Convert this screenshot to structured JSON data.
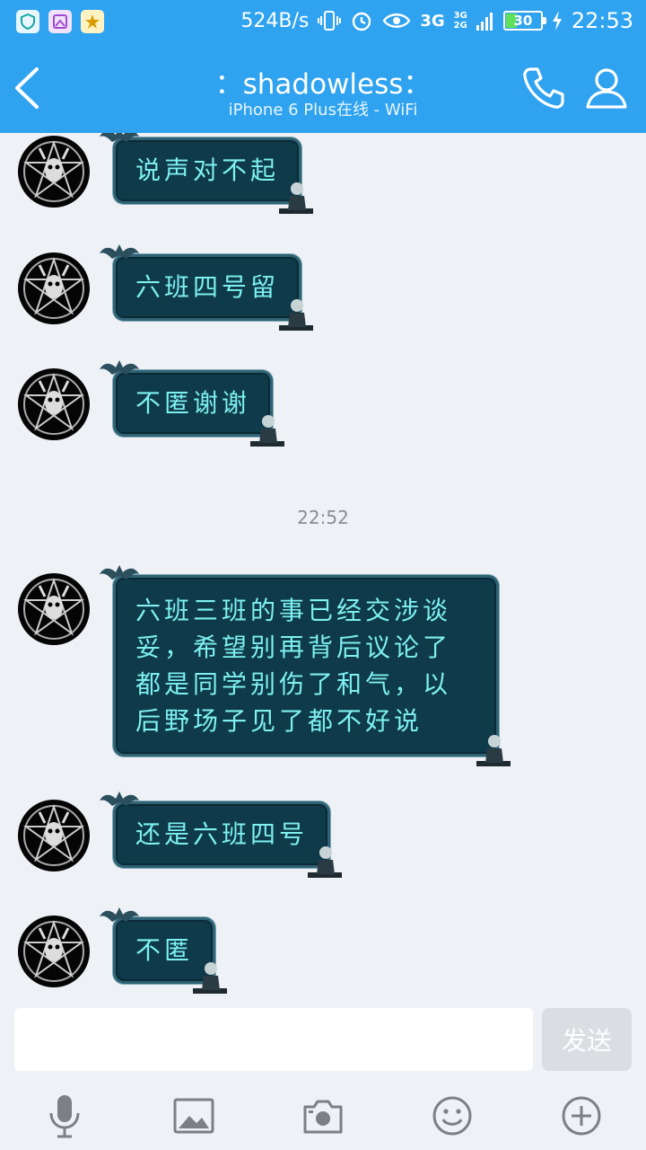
{
  "status_bar": {
    "net_speed": "524B/s",
    "signal1": "3G",
    "signal2_top": "3G",
    "signal2_bottom": "2G",
    "battery": "30",
    "time": "22:53",
    "icons": [
      "shield-icon",
      "gallery-app-icon",
      "star-app-icon",
      "vibrate-icon",
      "alarm-icon",
      "eye-icon"
    ]
  },
  "header": {
    "back_icon": "chevron-left-icon",
    "title": "：shadowless：",
    "subtitle": "iPhone 6 Plus在线 - WiFi",
    "call_icon": "phone-icon",
    "profile_icon": "person-icon"
  },
  "messages": [
    {
      "text": "说声对不起"
    },
    {
      "text": "六班四号留"
    },
    {
      "text": "不匿谢谢"
    },
    {
      "timestamp": "22:52"
    },
    {
      "text": "六班三班的事已经交涉谈妥，希望别再背后议论了都是同学别伤了和气，以后野场子见了都不好说"
    },
    {
      "text": "还是六班四号"
    },
    {
      "text": "不匿"
    }
  ],
  "input": {
    "value": "",
    "send_label": "发送"
  },
  "toolbar": [
    "microphone-icon",
    "image-icon",
    "camera-icon",
    "emoji-icon",
    "plus-icon"
  ],
  "colors": {
    "header_bg": "#2fa3ef",
    "bubble_bg": "#0e3a4a",
    "bubble_text": "#7ef0ef",
    "chat_bg": "#eef1f6"
  }
}
